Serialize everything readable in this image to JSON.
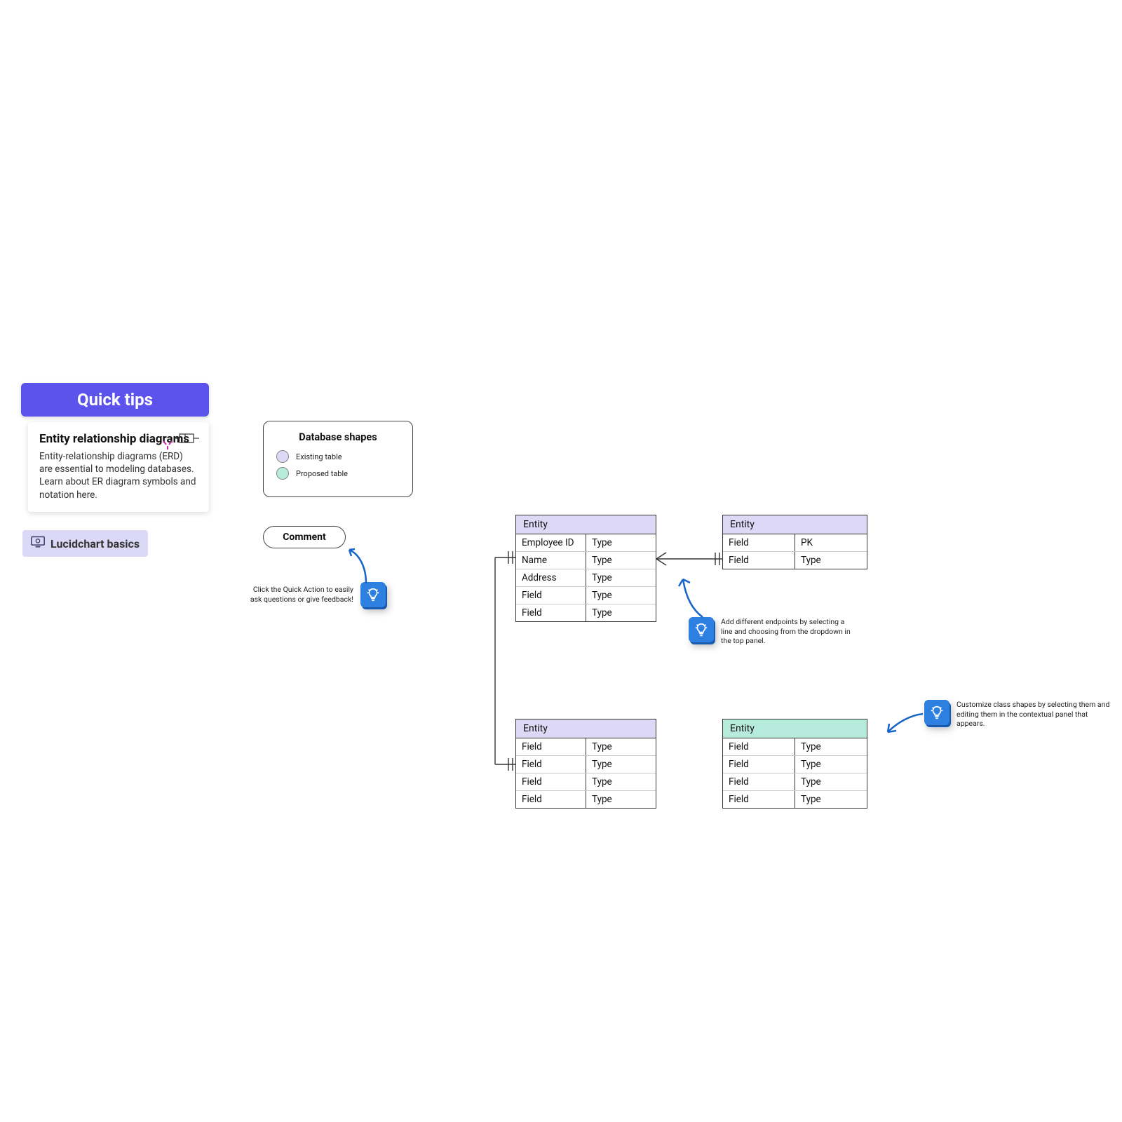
{
  "panel": {
    "header": "Quick tips",
    "tip_title": "Entity relationship diagrams",
    "tip_body": "Entity-relationship diagrams (ERD) are essential to modeling databases. Learn about ER diagram symbols and notation here.",
    "basics_label": "Lucidchart basics"
  },
  "legend": {
    "title": "Database shapes",
    "existing_label": "Existing table",
    "proposed_label": "Proposed table",
    "comment_label": "Comment"
  },
  "tips": {
    "quick_action": "Click the Quick Action to easily ask questions or give feedback!",
    "endpoints": "Add different endpoints by selecting a line and choosing from the dropdown in the top panel.",
    "customize": "Customize class shapes by selecting them and editing them in the contextual panel that appears."
  },
  "entities": {
    "e1": {
      "title": "Entity",
      "rows": [
        {
          "a": "Employee ID",
          "b": "Type"
        },
        {
          "a": "Name",
          "b": "Type"
        },
        {
          "a": "Address",
          "b": "Type"
        },
        {
          "a": "Field",
          "b": "Type"
        },
        {
          "a": "Field",
          "b": "Type"
        }
      ]
    },
    "e2": {
      "title": "Entity",
      "rows": [
        {
          "a": "Field",
          "b": "PK"
        },
        {
          "a": "Field",
          "b": "Type"
        }
      ]
    },
    "e3": {
      "title": "Entity",
      "rows": [
        {
          "a": "Field",
          "b": "Type"
        },
        {
          "a": "Field",
          "b": "Type"
        },
        {
          "a": "Field",
          "b": "Type"
        },
        {
          "a": "Field",
          "b": "Type"
        }
      ]
    },
    "e4": {
      "title": "Entity",
      "rows": [
        {
          "a": "Field",
          "b": "Type"
        },
        {
          "a": "Field",
          "b": "Type"
        },
        {
          "a": "Field",
          "b": "Type"
        },
        {
          "a": "Field",
          "b": "Type"
        }
      ]
    }
  },
  "colors": {
    "accent": "#5b53ec",
    "purple_light": "#dcd8f5",
    "teal_light": "#b7ecdc",
    "blue": "#2d7fe0"
  }
}
